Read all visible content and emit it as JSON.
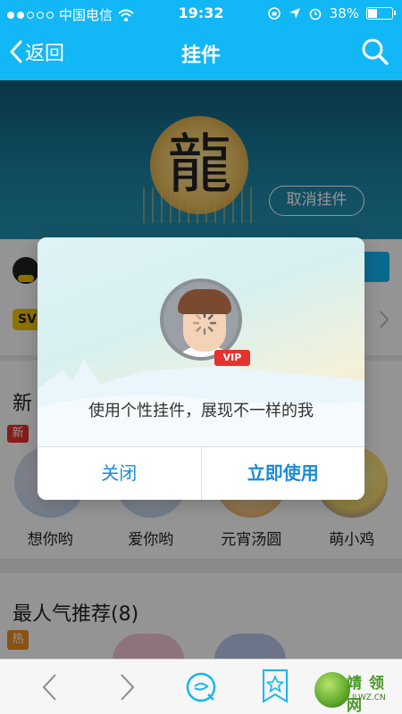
{
  "status_bar": {
    "carrier": "中国电信",
    "time": "19:32",
    "battery": "38%",
    "battery_level": 0.38
  },
  "nav": {
    "back_label": "返回",
    "title": "挂件"
  },
  "banner": {
    "cancel_label": "取消挂件"
  },
  "background": {
    "new_section_title_partial": "新",
    "new_badge": "新",
    "sv_badge": "SV",
    "items": [
      {
        "label": "想你哟"
      },
      {
        "label": "爱你哟"
      },
      {
        "label": "元宵汤圆"
      },
      {
        "label": "萌小鸡"
      }
    ],
    "popular_title": "最人气推荐(8)",
    "hot_badge": "热"
  },
  "dialog": {
    "vip_badge": "VIP",
    "message": "使用个性挂件，展现不一样的我",
    "close_label": "关闭",
    "use_label": "立即使用"
  },
  "watermark": {
    "name": "靖 领 网",
    "url": "JLWZ.CN"
  },
  "colors": {
    "brand_blue": "#12b7f5",
    "button_blue": "#1a8ad8",
    "vip_red": "#e5322d"
  }
}
